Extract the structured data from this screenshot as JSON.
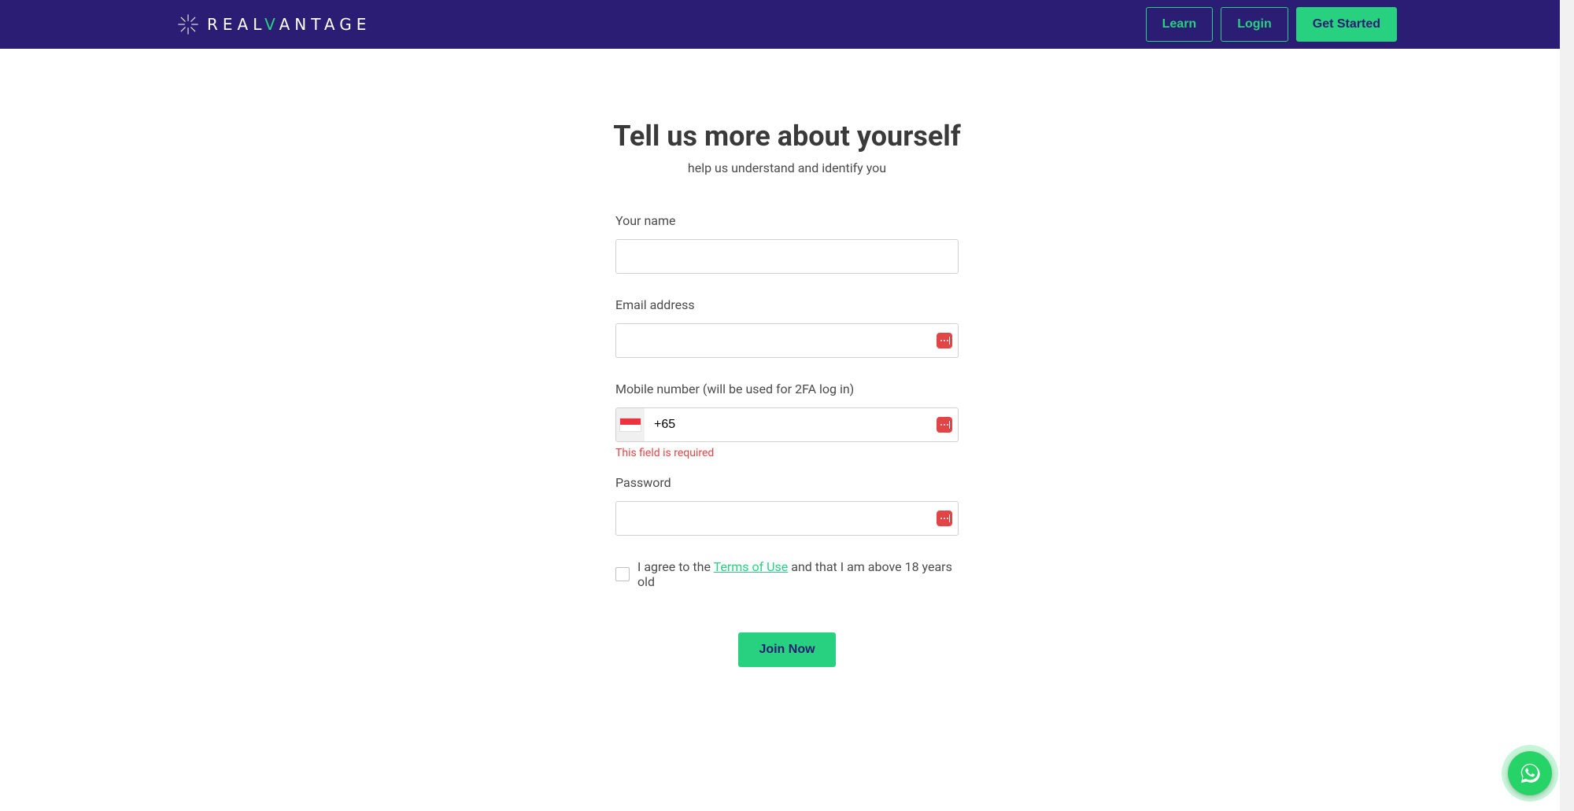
{
  "header": {
    "brand_prefix": "REAL",
    "brand_v": "V",
    "brand_suffix": "ANTAGE",
    "nav": {
      "learn": "Learn",
      "login": "Login",
      "get_started": "Get Started"
    }
  },
  "form": {
    "title": "Tell us more about yourself",
    "subtitle": "help us understand and identify you",
    "name_label": "Your name",
    "name_value": "",
    "email_label": "Email address",
    "email_value": "",
    "mobile_label": "Mobile number (will be used for 2FA log in)",
    "mobile_prefix": "+65",
    "mobile_value": "+65",
    "mobile_error": "This field is required",
    "password_label": "Password",
    "password_value": "",
    "agree_pre": "I agree to the ",
    "agree_link": "Terms of Use",
    "agree_post": " and that I am above 18 years old",
    "submit": "Join Now"
  },
  "icons": {
    "country_flag": "singapore-flag",
    "password_manager": "password-manager-icon",
    "chat": "whatsapp-icon"
  }
}
